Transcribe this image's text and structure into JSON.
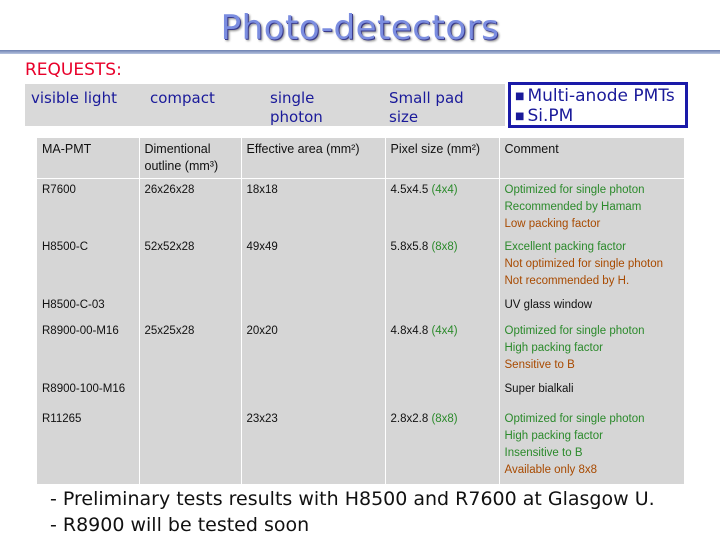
{
  "title": "Photo-detectors",
  "requests": {
    "label": "REQUESTS:",
    "items": [
      "visible light",
      "compact",
      "single photon",
      "Small pad size"
    ],
    "sidebox": [
      "Multi-anode PMTs",
      "Si.PM"
    ]
  },
  "table": {
    "headers": [
      "MA-PMT",
      "Dimentional outline (mm³)",
      "Effective area (mm²)",
      "Pixel size (mm²)",
      "Comment"
    ],
    "rows": [
      {
        "name": "R7600",
        "dim": "26x26x28",
        "area": "18x18",
        "pixel": "4.5x4.5",
        "pixel_count": "(4x4)",
        "comment": [
          "Optimized for single  photon",
          "Recommended by Hamam",
          "Low packing factor"
        ]
      },
      {
        "name": "H8500-C",
        "dim": "52x52x28",
        "area": "49x49",
        "pixel": "5.8x5.8",
        "pixel_count": "(8x8)",
        "comment": [
          "Excellent packing factor",
          "Not optimized for single  photon",
          "Not recommended by H."
        ]
      },
      {
        "name": "H8500-C-03",
        "dim": "",
        "area": "",
        "pixel": "",
        "pixel_count": "",
        "comment": [
          "UV glass window"
        ]
      },
      {
        "name": "R8900-00-M16",
        "dim": "25x25x28",
        "area": "20x20",
        "pixel": "4.8x4.8",
        "pixel_count": "(4x4)",
        "comment": [
          "Optimized for single photon",
          "High packing factor",
          "Sensitive to B"
        ]
      },
      {
        "name": "R8900-100-M16",
        "dim": "",
        "area": "",
        "pixel": "",
        "pixel_count": "",
        "comment": [
          "Super bialkali"
        ]
      },
      {
        "name": "R11265",
        "dim": "",
        "area": "23x23",
        "pixel": "2.8x2.8",
        "pixel_count": "(8x8)",
        "comment": [
          "Optimized for single photon",
          "High packing factor",
          "Insensitive to B",
          "Available only 8x8"
        ]
      }
    ]
  },
  "footer": [
    "- Preliminary tests results with H8500 and R7600 at Glasgow U.",
    "- R8900 will be tested soon"
  ],
  "colors": {
    "title": "#7b8de0",
    "requests": "#e8002a",
    "blue_text": "#1a1a9a",
    "green": "#2b8a2b",
    "orange": "#a84a00",
    "table_bg": "#d6d6d6"
  }
}
